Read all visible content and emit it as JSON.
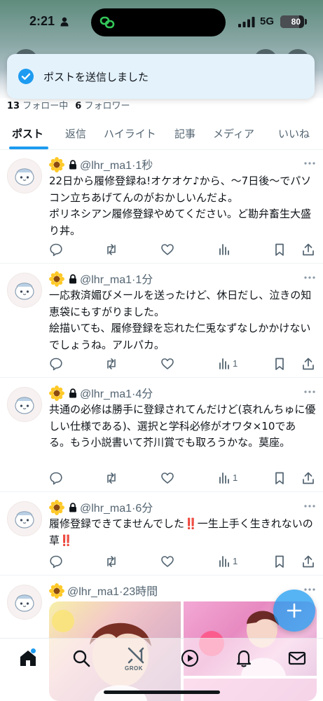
{
  "status_bar": {
    "time": "2:21",
    "network": "5G",
    "battery": "80",
    "battery_level": 0.8
  },
  "toast": {
    "message": "ポストを送信しました"
  },
  "profile": {
    "following_count": "13",
    "following_label": "フォロー中",
    "followers_count": "6",
    "followers_label": "フォロワー"
  },
  "tabs": [
    {
      "label": "ポスト",
      "active": true
    },
    {
      "label": "返信",
      "active": false
    },
    {
      "label": "ハイライト",
      "active": false
    },
    {
      "label": "記事",
      "active": false
    },
    {
      "label": "メディア",
      "active": false
    },
    {
      "label": "いいね",
      "active": false
    }
  ],
  "posts": [
    {
      "handle": "@lhr_ma1",
      "time": "·1秒",
      "protected": true,
      "text": "22日から履修登録ね!オケオケ♪から、〜7日後〜でパソコン立ちあげてんのがおかしいんだよ。\nポリネシアン履修登録やめてください。ど勘弁畜生大盛り丼。",
      "views": ""
    },
    {
      "handle": "@lhr_ma1",
      "time": "·1分",
      "protected": true,
      "text": "一応救済媚びメールを送ったけど、休日だし、泣きの知恵袋にもすがりました。\n絵描いても、履修登録を忘れた仁兎なずなしかかけないでしょうね。アルパカ。",
      "views": "1"
    },
    {
      "handle": "@lhr_ma1",
      "time": "·4分",
      "protected": true,
      "text": "共通の必修は勝手に登録されてんだけど(哀れんちゅに優しい仕様である)、選択と学科必修がオワタ×10である。もう小説書いて芥川賞でも取ろうかな。莫座。",
      "views": "1"
    },
    {
      "handle": "@lhr_ma1",
      "time": "·6分",
      "protected": true,
      "text": "履修登録できてませんでした‼️一生上手く生きれないの草‼️",
      "views": "1"
    },
    {
      "handle": "@lhr_ma1",
      "time": "·23時間",
      "protected": false,
      "text": "",
      "views": ""
    }
  ],
  "bottom_nav": {
    "grok_label": "GROK"
  },
  "colors": {
    "accent": "#1d9bf0",
    "text_primary": "#0f1419",
    "text_secondary": "#536471",
    "alert_red": "#e0245e"
  }
}
